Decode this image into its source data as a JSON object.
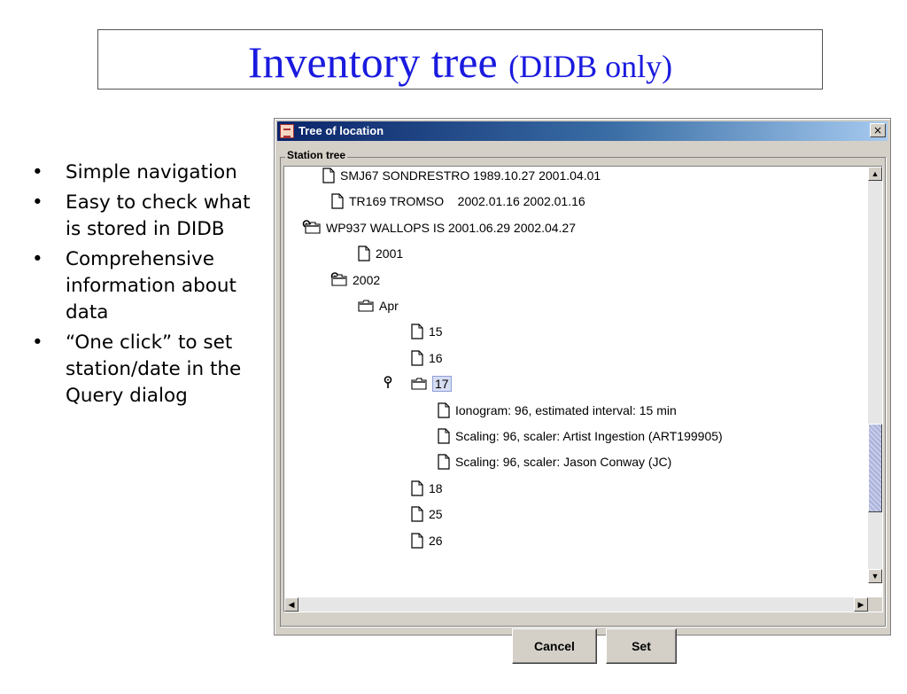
{
  "slide": {
    "title": "Inventory tree",
    "subtitle": "(DIDB only)",
    "bullets": [
      "Simple navigation",
      "Easy to check what is stored in DIDB",
      "Comprehensive information about data",
      "“One click” to set station/date in the Query dialog"
    ]
  },
  "window": {
    "title": "Tree of location",
    "close_label": "×",
    "group_title": "Station tree",
    "rows": [
      {
        "label": "SMJ67 SONDRESTRO 1989.10.27 2001.04.01",
        "icon": "doc-icon",
        "expanded": false
      },
      {
        "label": "TR169 TROMSO    2002.01.16 2002.01.16",
        "icon": "doc-icon",
        "expanded": false
      },
      {
        "label": "WP937 WALLOPS IS 2001.06.29 2002.04.27",
        "icon": "folder-icon",
        "expanded": true
      },
      {
        "label": "2001",
        "icon": "doc-icon",
        "expanded": false
      },
      {
        "label": "2002",
        "icon": "folder-icon",
        "expanded": true
      },
      {
        "label": "Apr",
        "icon": "folder-icon",
        "expanded": true
      },
      {
        "label": "15",
        "icon": "doc-icon",
        "expanded": false
      },
      {
        "label": "16",
        "icon": "doc-icon",
        "expanded": false
      },
      {
        "label": "17",
        "icon": "folder-icon",
        "expanded": true,
        "selected": true
      },
      {
        "label": "Ionogram: 96, estimated interval: 15 min",
        "icon": "doc-icon",
        "expanded": false
      },
      {
        "label": "Scaling: 96, scaler: Artist Ingestion (ART199905)",
        "icon": "doc-icon",
        "expanded": false
      },
      {
        "label": "Scaling: 96, scaler: Jason Conway (JC)",
        "icon": "doc-icon",
        "expanded": false
      },
      {
        "label": "18",
        "icon": "doc-icon",
        "expanded": false
      },
      {
        "label": "25",
        "icon": "doc-icon",
        "expanded": false
      },
      {
        "label": "26",
        "icon": "doc-icon",
        "expanded": false
      }
    ],
    "buttons": {
      "cancel": "Cancel",
      "set": "Set"
    }
  },
  "colors": {
    "title_blue": "#1a1adf",
    "titlebar_start": "#0a246a",
    "titlebar_end": "#a6caf0",
    "window_bg": "#d4d0c8",
    "selection_bg": "#d6dcf2"
  }
}
